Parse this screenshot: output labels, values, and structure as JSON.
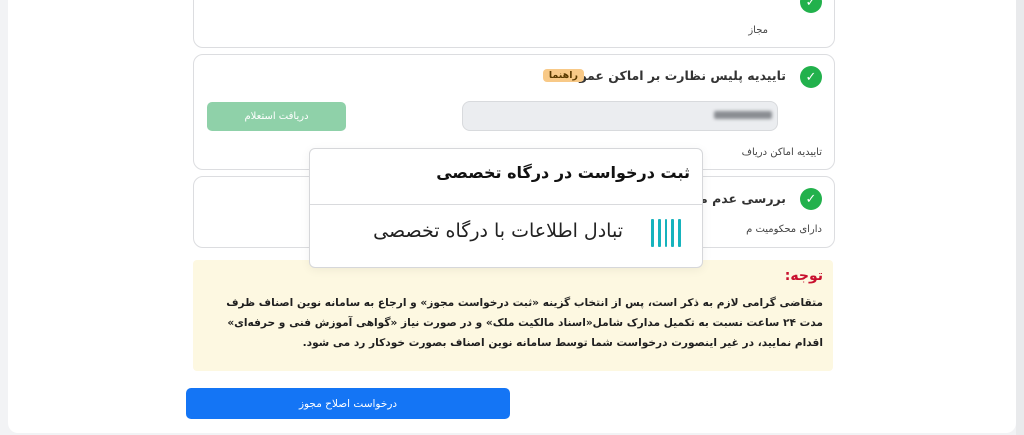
{
  "cards": [
    {
      "sub": "مجاز"
    },
    {
      "title": "تاییدیه پلیس نظارت بر اماکن عمومی",
      "badge": "راهنما",
      "button": "دریافت استعلام",
      "sub": "تاییدیه اماکن دریاف"
    },
    {
      "title": "بررسی عدم مح",
      "sub": "دارای محکومیت م"
    }
  ],
  "popup": {
    "title": "ثبت درخواست در درگاه تخصصی",
    "item": "تبادل اطلاعات با درگاه تخصصی"
  },
  "notice": {
    "heading": "توجه:",
    "body": "متقاضی گرامی لازم به ذکر است، پس از انتخاب گزینه «ثبت درخواست مجوز» و ارجاع به سامانه نوین اصناف ظرف مدت ۲۴ ساعت نسبت به تکمیل مدارک شامل«اسناد مالکیت ملک» و در صورت نیاز «گواهی آموزش فنی و حرفه‌ای» اقدام نمایید، در غیر اینصورت درخواست شما توسط سامانه نوین اصناف بصورت خودکار رد می شود."
  },
  "actions": {
    "license_fix": "درخواست  اصلاح  مجوز"
  },
  "colors": {
    "check": "#22b14c",
    "badge": "#f8c987",
    "primary": "#1475f5",
    "notice_bg": "#fdf8e1",
    "notice_heading": "#c8102e",
    "bars": "#16b3bd"
  }
}
